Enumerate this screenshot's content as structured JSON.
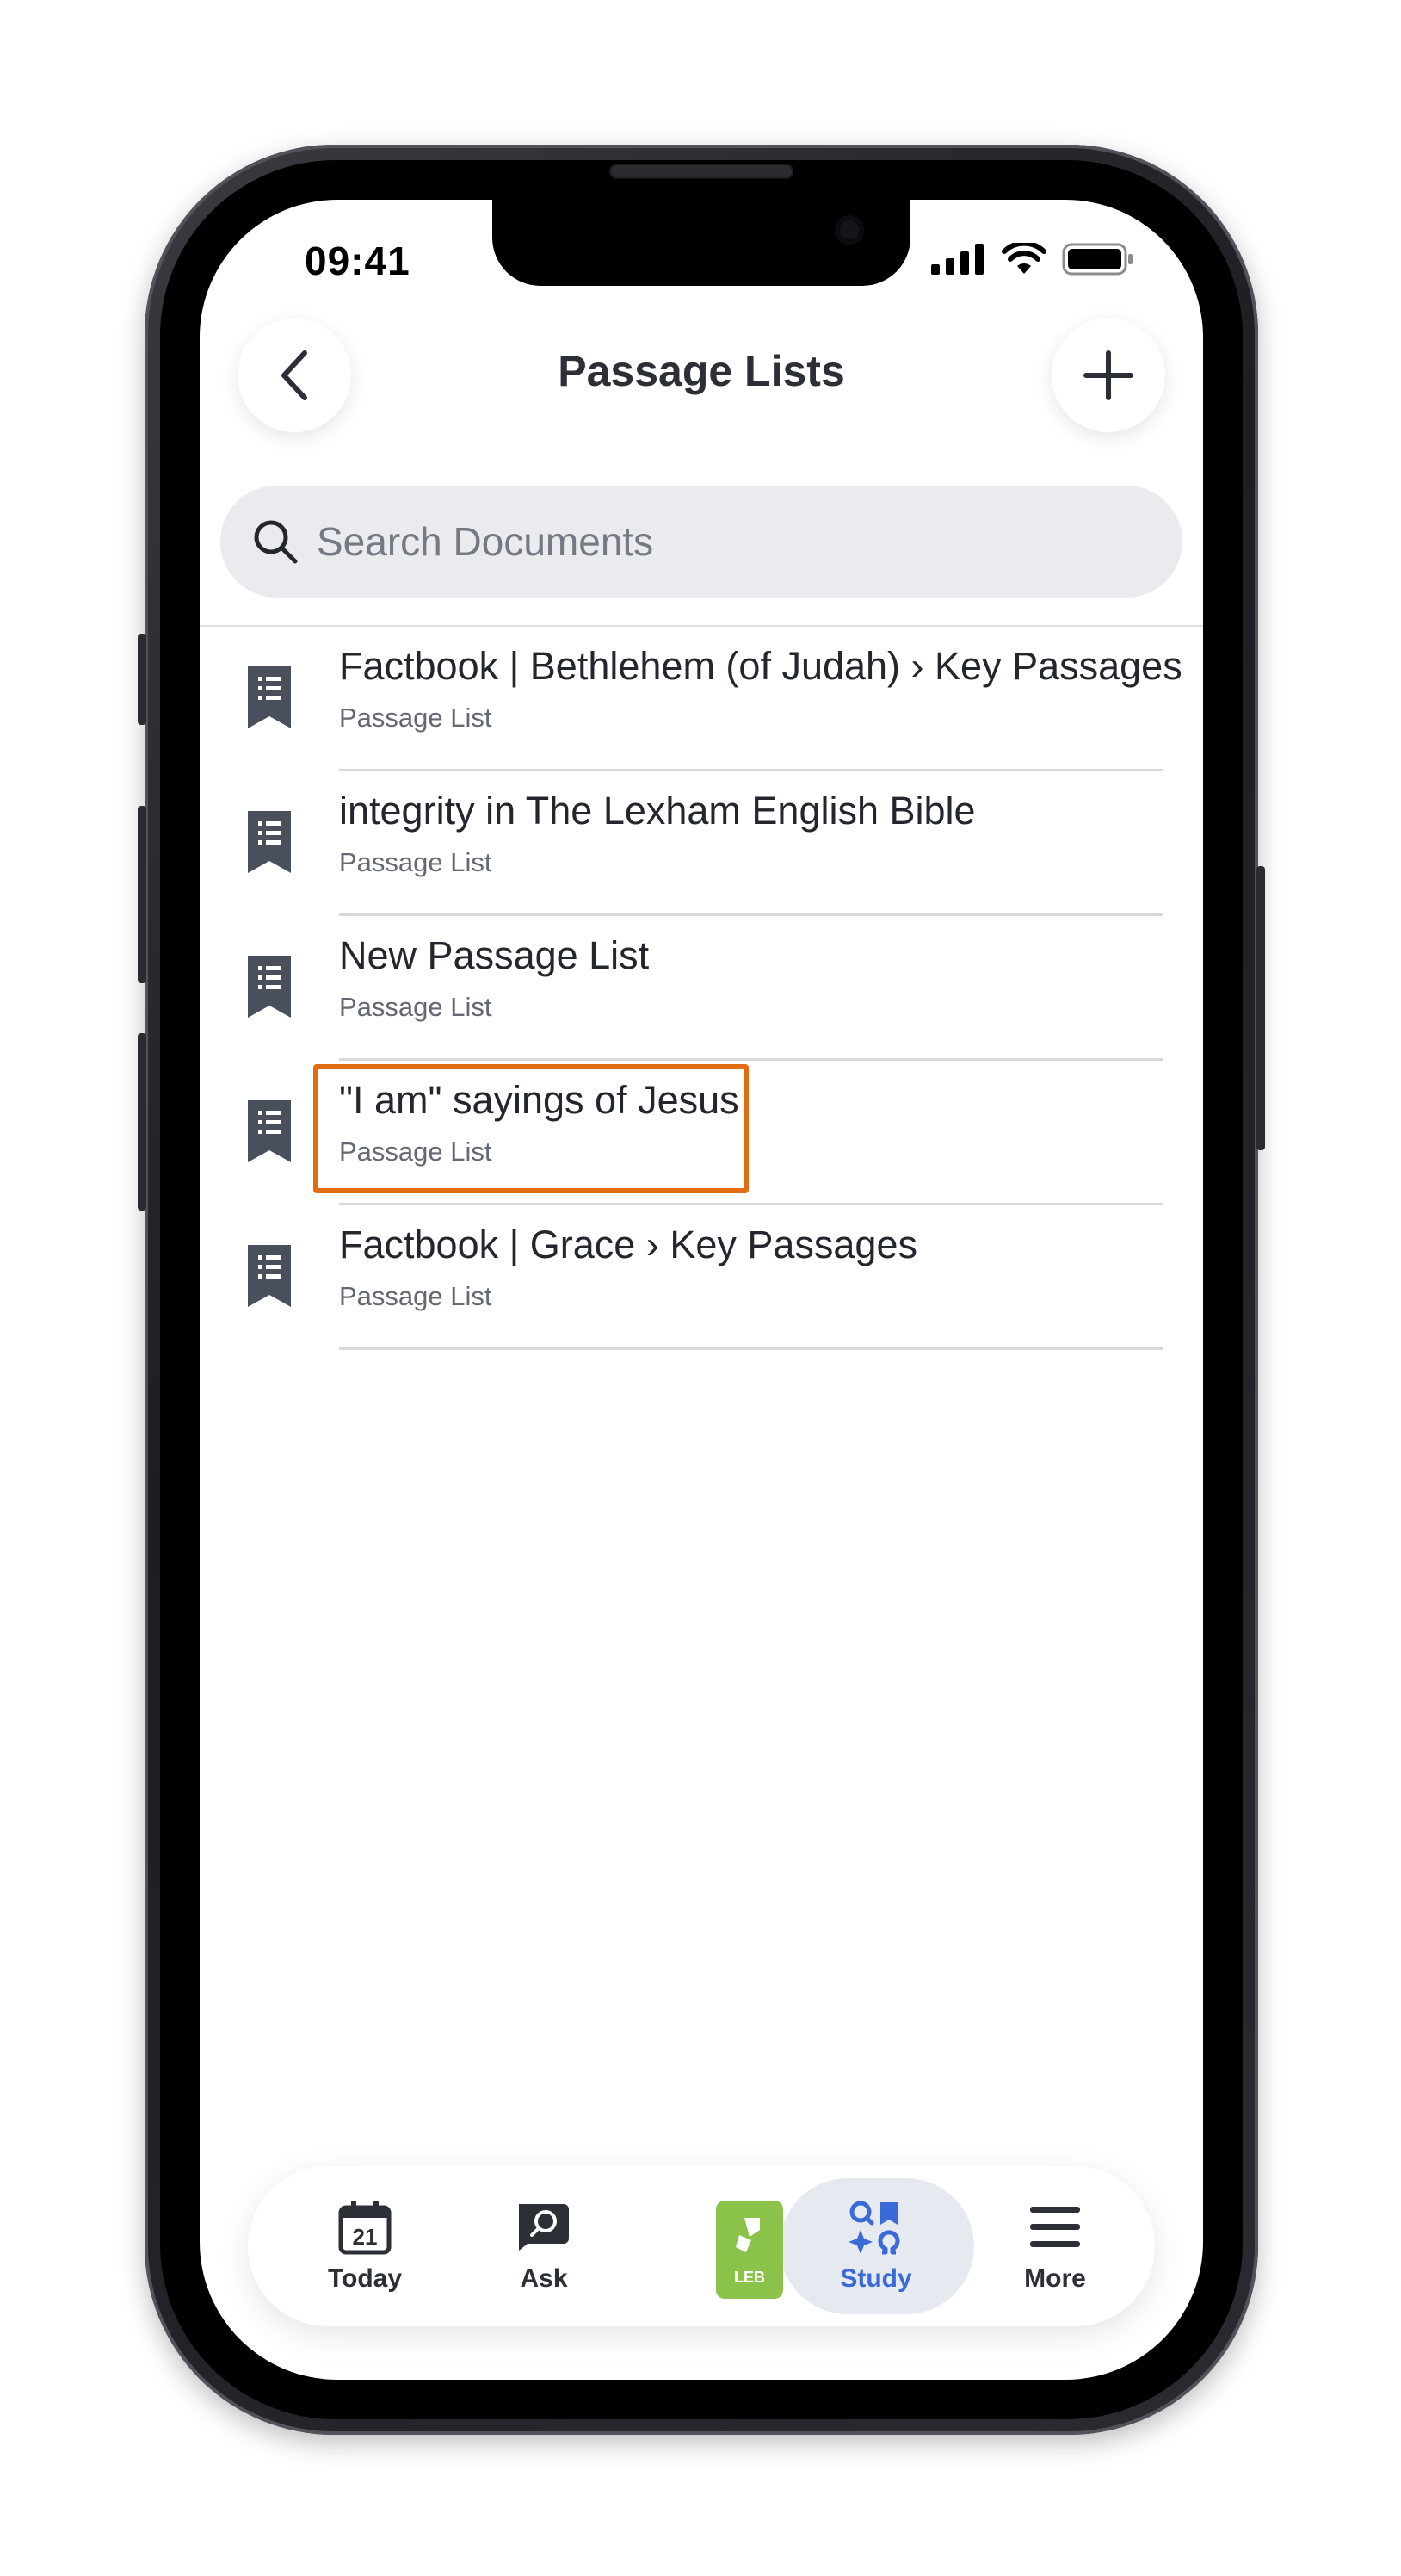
{
  "status": {
    "time": "09:41"
  },
  "header": {
    "title": "Passage Lists",
    "back_icon": "chevron-left-icon",
    "add_icon": "plus-icon"
  },
  "search": {
    "placeholder": "Search Documents"
  },
  "documents": [
    {
      "title": "Factbook | Bethlehem (of Judah) › Key Passages",
      "subtitle": "Passage List"
    },
    {
      "title": "integrity in The Lexham English Bible",
      "subtitle": "Passage List"
    },
    {
      "title": "New Passage List",
      "subtitle": "Passage List"
    },
    {
      "title": "\"I am\" sayings of Jesus",
      "subtitle": "Passage List",
      "highlighted": true
    },
    {
      "title": "Factbook | Grace › Key Passages",
      "subtitle": "Passage List"
    }
  ],
  "tabbar": {
    "today": {
      "label": "Today",
      "calendar_day": "21"
    },
    "ask": {
      "label": "Ask"
    },
    "bible": {
      "badge": "LEB"
    },
    "study": {
      "label": "Study",
      "active": true
    },
    "more": {
      "label": "More"
    }
  },
  "colors": {
    "accent": "#3a6ad8",
    "highlight": "#e36c12",
    "leb_green": "#8bc34a",
    "icon_dark": "#4a4f5c"
  }
}
